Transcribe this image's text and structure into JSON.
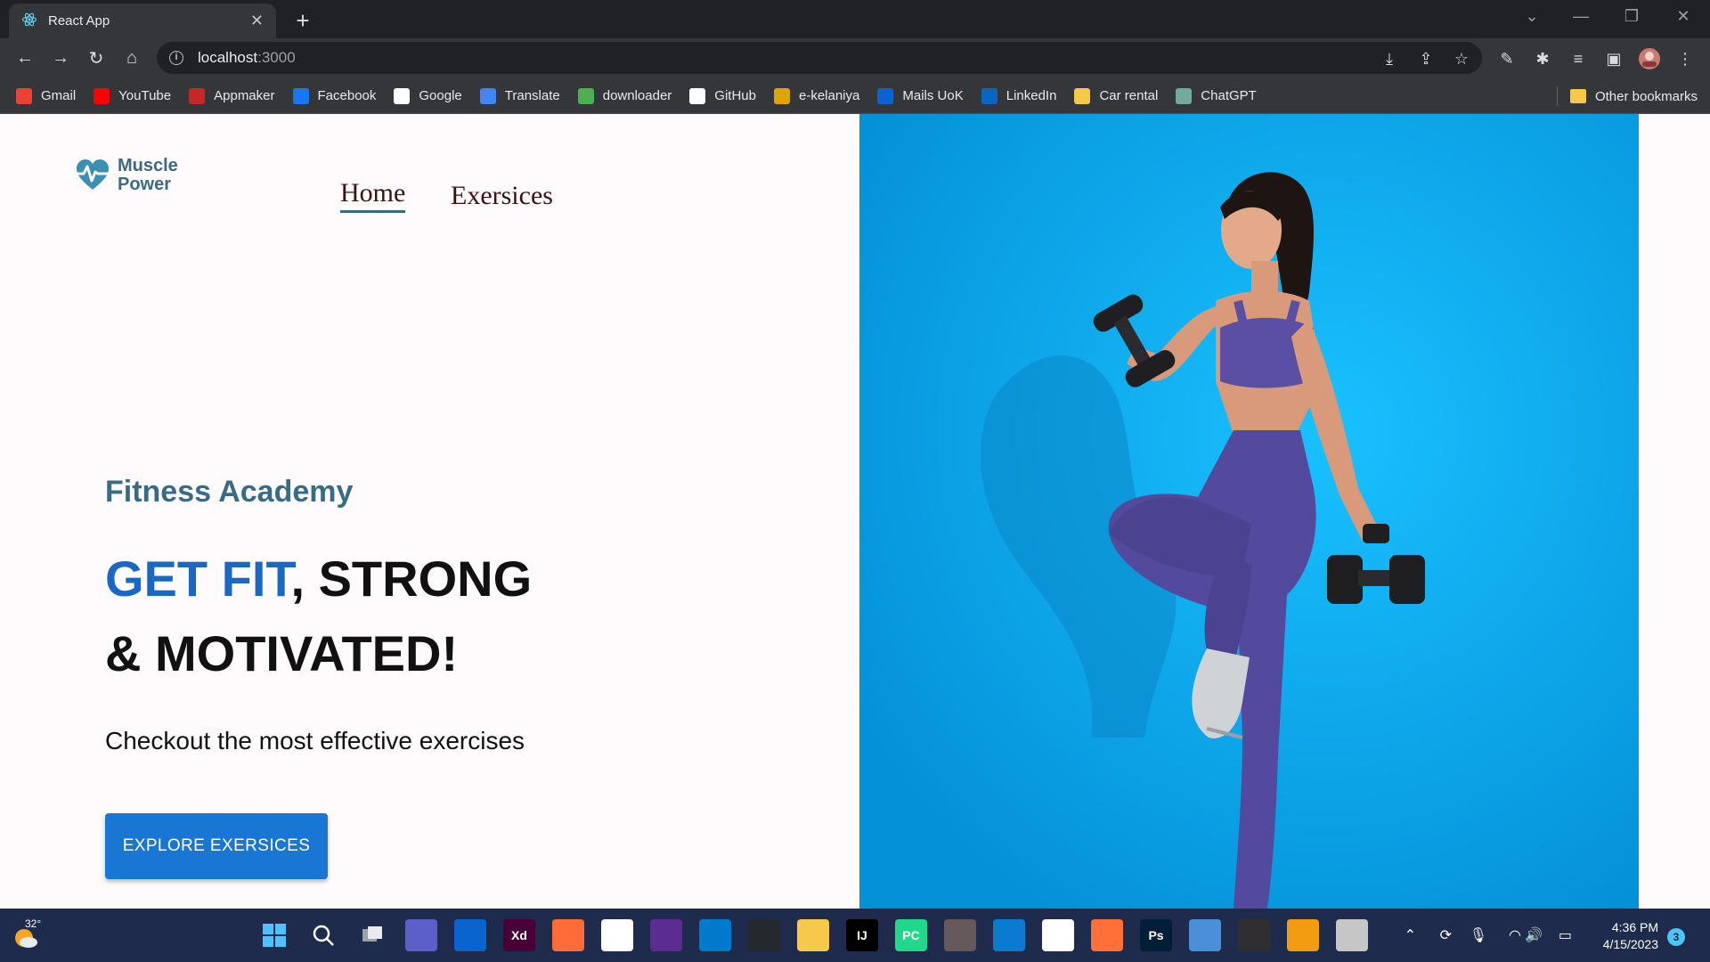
{
  "browser": {
    "tab_title": "React App",
    "tab_close": "✕",
    "new_tab": "+",
    "url_host": "localhost",
    "url_port": ":3000",
    "bookmarks": [
      {
        "label": "Gmail",
        "icon": "gmail-icon",
        "color": "#ea4335"
      },
      {
        "label": "YouTube",
        "icon": "youtube-icon",
        "color": "#ff0000"
      },
      {
        "label": "Appmaker",
        "icon": "appmaker-icon",
        "color": "#c62828"
      },
      {
        "label": "Facebook",
        "icon": "facebook-icon",
        "color": "#1877f2"
      },
      {
        "label": "Google",
        "icon": "google-icon",
        "color": "#ffffff"
      },
      {
        "label": "Translate",
        "icon": "translate-icon",
        "color": "#4285f4"
      },
      {
        "label": "downloader",
        "icon": "download-icon",
        "color": "#4caf50"
      },
      {
        "label": "GitHub",
        "icon": "github-icon",
        "color": "#ffffff"
      },
      {
        "label": "e-kelaniya",
        "icon": "ekelaniya-icon",
        "color": "#e0a400"
      },
      {
        "label": "Mails UoK",
        "icon": "outlook-icon",
        "color": "#0a64d0"
      },
      {
        "label": "LinkedIn",
        "icon": "linkedin-icon",
        "color": "#0a66c2"
      },
      {
        "label": "Car rental",
        "icon": "folder-icon",
        "color": "#f6c94a"
      },
      {
        "label": "ChatGPT",
        "icon": "chatgpt-icon",
        "color": "#74aa9c"
      }
    ],
    "other_bookmarks": "Other bookmarks"
  },
  "page": {
    "nav": {
      "home": "Home",
      "exercises": "Exersices"
    },
    "logo": {
      "line1": "Muscle",
      "line2": "Power"
    },
    "hero": {
      "academy": "Fitness Academy",
      "headline_accent": "GET FIT",
      "headline_rest": ", STRONG",
      "headline_line2": "& MOTIVATED!",
      "tagline": "Checkout the most effective exercises",
      "cta": "EXPLORE EXERSICES"
    },
    "colors": {
      "accent": "#1976d2",
      "brand": "#3a6b85",
      "hero_bg": "#08b2f0"
    }
  },
  "taskbar": {
    "weather_temp": "32°",
    "time": "4:36 PM",
    "date": "4/15/2023",
    "notifications": "3",
    "apps": [
      {
        "name": "start-icon",
        "label": ""
      },
      {
        "name": "search-icon",
        "label": ""
      },
      {
        "name": "task-view-icon",
        "label": ""
      },
      {
        "name": "chat-icon",
        "label": ""
      },
      {
        "name": "mail-icon",
        "label": ""
      },
      {
        "name": "adobe-xd-icon",
        "label": "Xd"
      },
      {
        "name": "postman-icon",
        "label": ""
      },
      {
        "name": "slack-icon",
        "label": ""
      },
      {
        "name": "visual-studio-icon",
        "label": ""
      },
      {
        "name": "vscode-icon",
        "label": ""
      },
      {
        "name": "github-desktop-icon",
        "label": ""
      },
      {
        "name": "file-explorer-icon",
        "label": ""
      },
      {
        "name": "intellij-icon",
        "label": "IJ"
      },
      {
        "name": "pycharm-icon",
        "label": "PC"
      },
      {
        "name": "atom-icon",
        "label": ""
      },
      {
        "name": "edge-icon",
        "label": ""
      },
      {
        "name": "chrome-icon",
        "label": ""
      },
      {
        "name": "firefox-icon",
        "label": ""
      },
      {
        "name": "photoshop-icon",
        "label": "Ps"
      },
      {
        "name": "notepad-icon",
        "label": ""
      },
      {
        "name": "obs-icon",
        "label": ""
      },
      {
        "name": "media-player-icon",
        "label": ""
      },
      {
        "name": "snipping-tool-icon",
        "label": ""
      }
    ]
  }
}
